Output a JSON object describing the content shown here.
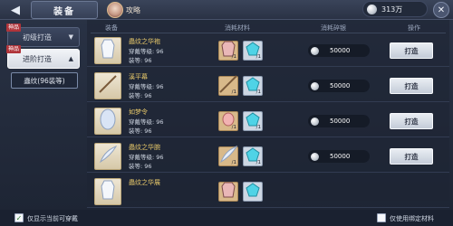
{
  "topbar": {
    "back_icon": "back-arrow-icon",
    "title": "装备",
    "strategy_label": "攻略",
    "currency_value": "313万",
    "close_icon": "close-icon"
  },
  "sidebar": {
    "basic": {
      "label": "初级打造",
      "badge": "神品"
    },
    "advanced": {
      "label": "进阶打造",
      "badge": "神品"
    },
    "sub_item": "蟲纹(96装等)"
  },
  "table": {
    "headers": {
      "equipment": "装备",
      "materials": "消耗材料",
      "silver": "消耗碎银",
      "action": "操作"
    },
    "rows": [
      {
        "name": "蟲纹之华袍",
        "wear_level": "穿戴等级: 96",
        "gear_level": "装等: 96",
        "item_icon": "robe-icon",
        "materials": [
          {
            "icon": "armor-icon",
            "count": "/1"
          },
          {
            "icon": "gem-icon",
            "count": "/1"
          }
        ],
        "cost": "50000",
        "action": "打造"
      },
      {
        "name": "溪平幕",
        "wear_level": "穿戴等级: 96",
        "gear_level": "装等: 96",
        "item_icon": "staff-icon",
        "materials": [
          {
            "icon": "staff-icon",
            "count": "/1"
          },
          {
            "icon": "gem-icon",
            "count": "/1"
          }
        ],
        "cost": "50000",
        "action": "打造"
      },
      {
        "name": "如梦令",
        "wear_level": "穿戴等级: 96",
        "gear_level": "装等: 96",
        "item_icon": "fan-icon",
        "materials": [
          {
            "icon": "egg-icon",
            "count": "/1"
          },
          {
            "icon": "gem-icon",
            "count": "/1"
          }
        ],
        "cost": "50000",
        "action": "打造"
      },
      {
        "name": "蟲纹之华腕",
        "wear_level": "穿戴等级: 96",
        "gear_level": "装等: 96",
        "item_icon": "feather-icon",
        "materials": [
          {
            "icon": "feather-icon",
            "count": "/1"
          },
          {
            "icon": "gem-icon",
            "count": "/1"
          }
        ],
        "cost": "50000",
        "action": "打造"
      },
      {
        "name": "蟲纹之华展",
        "wear_level": "",
        "gear_level": "",
        "item_icon": "robe-icon",
        "materials": [
          {
            "icon": "armor-icon",
            "count": ""
          },
          {
            "icon": "gem-icon",
            "count": ""
          }
        ],
        "cost": "",
        "action": ""
      }
    ]
  },
  "bottom": {
    "show_wearable_label": "仅显示当前可穿戴",
    "show_wearable_checked": "✓",
    "use_bound_label": "仅使用绑定材料",
    "use_bound_checked": ""
  }
}
